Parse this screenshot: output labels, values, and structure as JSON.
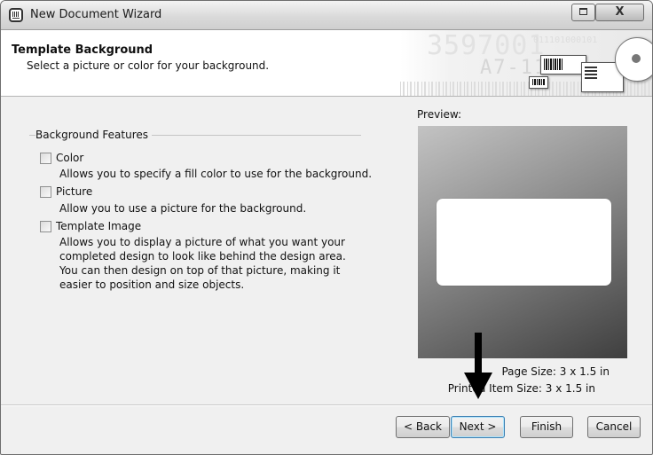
{
  "window": {
    "title": "New Document Wizard"
  },
  "header": {
    "title": "Template Background",
    "subtitle": "Select a picture or color for your background."
  },
  "background_features": {
    "group_title": "Background Features",
    "options": [
      {
        "label": "Color",
        "checked": false,
        "description": "Allows you to specify a fill color to use for the background."
      },
      {
        "label": "Picture",
        "checked": false,
        "description": "Allow you to use a picture for the background."
      },
      {
        "label": "Template Image",
        "checked": false,
        "description": "Allows you to display a picture of what you want your completed design to look like behind the design area. You can then design on top of that picture, making it easier to position and size objects."
      }
    ]
  },
  "preview": {
    "label": "Preview:",
    "page_size": "Page Size:  3 x 1.5 in",
    "item_size": "Printed Item Size:  3 x 1.5 in"
  },
  "buttons": {
    "back": "< Back",
    "next": "Next >",
    "finish": "Finish",
    "cancel": "Cancel"
  },
  "banner": {
    "big_number": "3597001",
    "code": "A7-118",
    "small_number": "011101000101"
  }
}
